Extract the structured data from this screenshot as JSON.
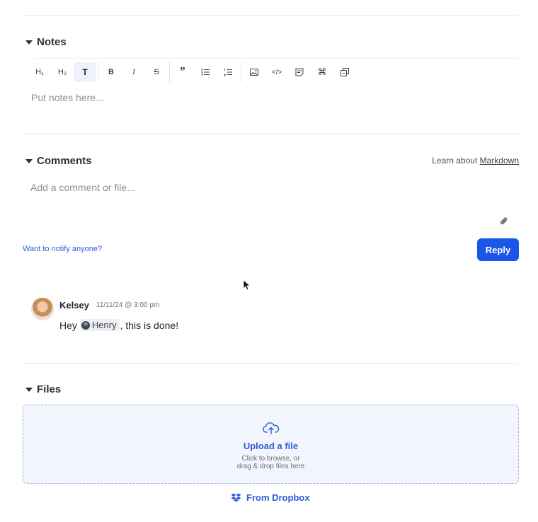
{
  "notes": {
    "title": "Notes",
    "toolbar": [
      {
        "name": "h1",
        "label": "H₁"
      },
      {
        "name": "h2",
        "label": "H₂"
      },
      {
        "name": "text",
        "label": "T"
      },
      {
        "name": "bold",
        "label": "B"
      },
      {
        "name": "italic",
        "label": "I"
      },
      {
        "name": "strikethrough",
        "label": "S"
      },
      {
        "name": "quote",
        "label": "”"
      },
      {
        "name": "bullet-list",
        "label": "•"
      },
      {
        "name": "numbered-list",
        "label": "1"
      },
      {
        "name": "image",
        "label": ""
      },
      {
        "name": "code",
        "label": "</>"
      },
      {
        "name": "embed",
        "label": ""
      },
      {
        "name": "command",
        "label": "⌘"
      },
      {
        "name": "copy",
        "label": ""
      }
    ],
    "placeholder": "Put notes here..."
  },
  "comments": {
    "title": "Comments",
    "learn_prefix": "Learn about",
    "learn_link": "Markdown",
    "placeholder": "Add a comment or file...",
    "notify_link": "Want to notify anyone?",
    "reply_label": "Reply",
    "items": [
      {
        "author": "Kelsey",
        "timestamp": "11/11/24 @ 3:00 pm",
        "text_before": "Hey",
        "mention": "Henry",
        "text_after": ", this is done!"
      }
    ]
  },
  "files": {
    "title": "Files",
    "upload_title": "Upload a file",
    "upload_line1": "Click to browse, or",
    "upload_line2": "drag & drop files here",
    "dropbox_label": "From Dropbox"
  },
  "colors": {
    "accent": "#1a56e8",
    "link": "#2f5bd8",
    "dropzone_bg": "#f3f5fd"
  }
}
